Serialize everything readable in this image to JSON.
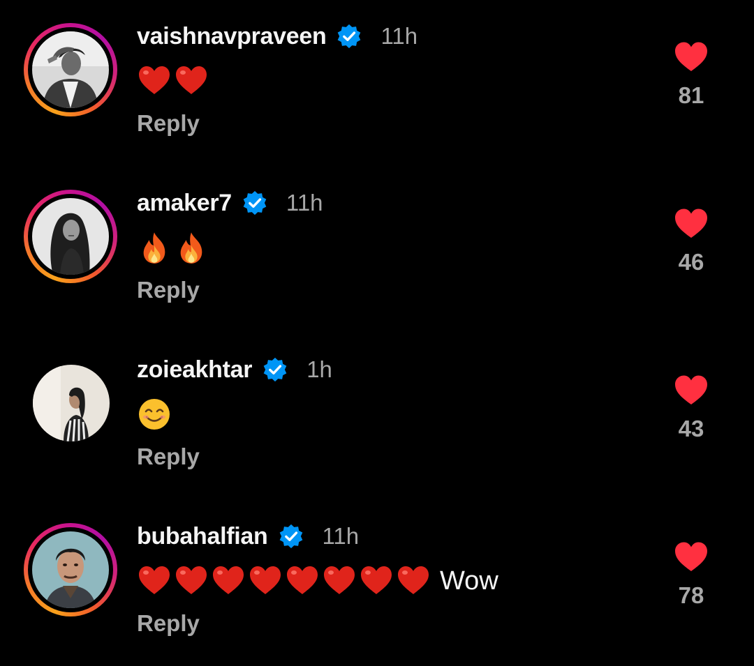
{
  "comments": [
    {
      "username": "vaishnavpraveen",
      "time": "11h",
      "emoji": "heart",
      "emoji_count": 2,
      "text": "",
      "reply_label": "Reply",
      "likes": "81",
      "story_ring": true
    },
    {
      "username": "amaker7",
      "time": "11h",
      "emoji": "fire",
      "emoji_count": 2,
      "text": "",
      "reply_label": "Reply",
      "likes": "46",
      "story_ring": true
    },
    {
      "username": "zoieakhtar",
      "time": "1h",
      "emoji": "smile",
      "emoji_count": 1,
      "text": "",
      "reply_label": "Reply",
      "likes": "43",
      "story_ring": false
    },
    {
      "username": "bubahalfian",
      "time": "11h",
      "emoji": "heart",
      "emoji_count": 8,
      "text": "Wow",
      "reply_label": "Reply",
      "likes": "78",
      "story_ring": true
    }
  ],
  "colors": {
    "background": "#000000",
    "like_red": "#ff3040",
    "verified_blue": "#0095f6",
    "secondary_text": "#a8a8a8"
  },
  "icons": {
    "verified": "verified-badge-icon",
    "like": "heart-icon"
  }
}
